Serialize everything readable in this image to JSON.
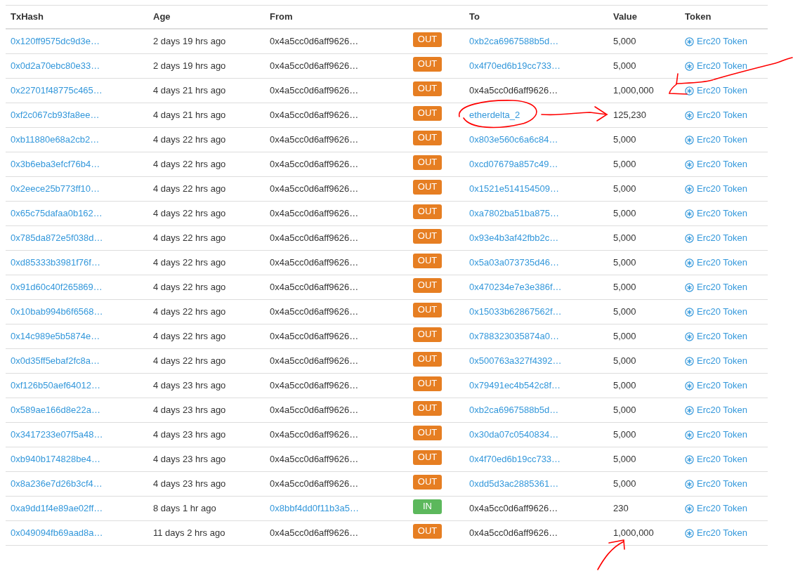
{
  "table": {
    "columns": [
      "TxHash",
      "Age",
      "From",
      "To",
      "Value",
      "Token"
    ],
    "rows": [
      {
        "txhash": "0x120ff9575dc9d3e…",
        "age": "2 days 19 hrs ago",
        "from": {
          "text": "0x4a5cc0d6aff9626…",
          "link": false
        },
        "direction": {
          "label": "OUT",
          "kind": "out"
        },
        "to": {
          "text": "0xb2ca6967588b5d…",
          "link": true
        },
        "value": "5,000",
        "token": "Erc20 Token"
      },
      {
        "txhash": "0x0d2a70ebc80e33…",
        "age": "2 days 19 hrs ago",
        "from": {
          "text": "0x4a5cc0d6aff9626…",
          "link": false
        },
        "direction": {
          "label": "OUT",
          "kind": "out"
        },
        "to": {
          "text": "0x4f70ed6b19cc733…",
          "link": true
        },
        "value": "5,000",
        "token": "Erc20 Token"
      },
      {
        "txhash": "0x22701f48775c465…",
        "age": "4 days 21 hrs ago",
        "from": {
          "text": "0x4a5cc0d6aff9626…",
          "link": false
        },
        "direction": {
          "label": "OUT",
          "kind": "out"
        },
        "to": {
          "text": "0x4a5cc0d6aff9626…",
          "link": false
        },
        "value": "1,000,000",
        "token": "Erc20 Token"
      },
      {
        "txhash": "0xf2c067cb93fa8ee…",
        "age": "4 days 21 hrs ago",
        "from": {
          "text": "0x4a5cc0d6aff9626…",
          "link": false
        },
        "direction": {
          "label": "OUT",
          "kind": "out"
        },
        "to": {
          "text": "etherdelta_2",
          "link": true
        },
        "value": "125,230",
        "token": "Erc20 Token"
      },
      {
        "txhash": "0xb11880e68a2cb2…",
        "age": "4 days 22 hrs ago",
        "from": {
          "text": "0x4a5cc0d6aff9626…",
          "link": false
        },
        "direction": {
          "label": "OUT",
          "kind": "out"
        },
        "to": {
          "text": "0x803e560c6a6c84…",
          "link": true
        },
        "value": "5,000",
        "token": "Erc20 Token"
      },
      {
        "txhash": "0x3b6eba3efcf76b4…",
        "age": "4 days 22 hrs ago",
        "from": {
          "text": "0x4a5cc0d6aff9626…",
          "link": false
        },
        "direction": {
          "label": "OUT",
          "kind": "out"
        },
        "to": {
          "text": "0xcd07679a857c49…",
          "link": true
        },
        "value": "5,000",
        "token": "Erc20 Token"
      },
      {
        "txhash": "0x2eece25b773ff10…",
        "age": "4 days 22 hrs ago",
        "from": {
          "text": "0x4a5cc0d6aff9626…",
          "link": false
        },
        "direction": {
          "label": "OUT",
          "kind": "out"
        },
        "to": {
          "text": "0x1521e514154509…",
          "link": true
        },
        "value": "5,000",
        "token": "Erc20 Token"
      },
      {
        "txhash": "0x65c75dafaa0b162…",
        "age": "4 days 22 hrs ago",
        "from": {
          "text": "0x4a5cc0d6aff9626…",
          "link": false
        },
        "direction": {
          "label": "OUT",
          "kind": "out"
        },
        "to": {
          "text": "0xa7802ba51ba875…",
          "link": true
        },
        "value": "5,000",
        "token": "Erc20 Token"
      },
      {
        "txhash": "0x785da872e5f038d…",
        "age": "4 days 22 hrs ago",
        "from": {
          "text": "0x4a5cc0d6aff9626…",
          "link": false
        },
        "direction": {
          "label": "OUT",
          "kind": "out"
        },
        "to": {
          "text": "0x93e4b3af42fbb2c…",
          "link": true
        },
        "value": "5,000",
        "token": "Erc20 Token"
      },
      {
        "txhash": "0xd85333b3981f76f…",
        "age": "4 days 22 hrs ago",
        "from": {
          "text": "0x4a5cc0d6aff9626…",
          "link": false
        },
        "direction": {
          "label": "OUT",
          "kind": "out"
        },
        "to": {
          "text": "0x5a03a073735d46…",
          "link": true
        },
        "value": "5,000",
        "token": "Erc20 Token"
      },
      {
        "txhash": "0x91d60c40f265869…",
        "age": "4 days 22 hrs ago",
        "from": {
          "text": "0x4a5cc0d6aff9626…",
          "link": false
        },
        "direction": {
          "label": "OUT",
          "kind": "out"
        },
        "to": {
          "text": "0x470234e7e3e386f…",
          "link": true
        },
        "value": "5,000",
        "token": "Erc20 Token"
      },
      {
        "txhash": "0x10bab994b6f6568…",
        "age": "4 days 22 hrs ago",
        "from": {
          "text": "0x4a5cc0d6aff9626…",
          "link": false
        },
        "direction": {
          "label": "OUT",
          "kind": "out"
        },
        "to": {
          "text": "0x15033b62867562f…",
          "link": true
        },
        "value": "5,000",
        "token": "Erc20 Token"
      },
      {
        "txhash": "0x14c989e5b5874e…",
        "age": "4 days 22 hrs ago",
        "from": {
          "text": "0x4a5cc0d6aff9626…",
          "link": false
        },
        "direction": {
          "label": "OUT",
          "kind": "out"
        },
        "to": {
          "text": "0x788323035874a0…",
          "link": true
        },
        "value": "5,000",
        "token": "Erc20 Token"
      },
      {
        "txhash": "0x0d35ff5ebaf2fc8a…",
        "age": "4 days 22 hrs ago",
        "from": {
          "text": "0x4a5cc0d6aff9626…",
          "link": false
        },
        "direction": {
          "label": "OUT",
          "kind": "out"
        },
        "to": {
          "text": "0x500763a327f4392…",
          "link": true
        },
        "value": "5,000",
        "token": "Erc20 Token"
      },
      {
        "txhash": "0xf126b50aef64012…",
        "age": "4 days 23 hrs ago",
        "from": {
          "text": "0x4a5cc0d6aff9626…",
          "link": false
        },
        "direction": {
          "label": "OUT",
          "kind": "out"
        },
        "to": {
          "text": "0x79491ec4b542c8f…",
          "link": true
        },
        "value": "5,000",
        "token": "Erc20 Token"
      },
      {
        "txhash": "0x589ae166d8e22a…",
        "age": "4 days 23 hrs ago",
        "from": {
          "text": "0x4a5cc0d6aff9626…",
          "link": false
        },
        "direction": {
          "label": "OUT",
          "kind": "out"
        },
        "to": {
          "text": "0xb2ca6967588b5d…",
          "link": true
        },
        "value": "5,000",
        "token": "Erc20 Token"
      },
      {
        "txhash": "0x3417233e07f5a48…",
        "age": "4 days 23 hrs ago",
        "from": {
          "text": "0x4a5cc0d6aff9626…",
          "link": false
        },
        "direction": {
          "label": "OUT",
          "kind": "out"
        },
        "to": {
          "text": "0x30da07c0540834…",
          "link": true
        },
        "value": "5,000",
        "token": "Erc20 Token"
      },
      {
        "txhash": "0xb940b174828be4…",
        "age": "4 days 23 hrs ago",
        "from": {
          "text": "0x4a5cc0d6aff9626…",
          "link": false
        },
        "direction": {
          "label": "OUT",
          "kind": "out"
        },
        "to": {
          "text": "0x4f70ed6b19cc733…",
          "link": true
        },
        "value": "5,000",
        "token": "Erc20 Token"
      },
      {
        "txhash": "0x8a236e7d26b3cf4…",
        "age": "4 days 23 hrs ago",
        "from": {
          "text": "0x4a5cc0d6aff9626…",
          "link": false
        },
        "direction": {
          "label": "OUT",
          "kind": "out"
        },
        "to": {
          "text": "0xdd5d3ac2885361…",
          "link": true
        },
        "value": "5,000",
        "token": "Erc20 Token"
      },
      {
        "txhash": "0xa9dd1f4e89ae02ff…",
        "age": "8 days 1 hr ago",
        "from": {
          "text": "0x8bbf4dd0f11b3a5…",
          "link": true
        },
        "direction": {
          "label": "IN",
          "kind": "in"
        },
        "to": {
          "text": "0x4a5cc0d6aff9626…",
          "link": false
        },
        "value": "230",
        "token": "Erc20 Token"
      },
      {
        "txhash": "0x049094fb69aad8a…",
        "age": "11 days 2 hrs ago",
        "from": {
          "text": "0x4a5cc0d6aff9626…",
          "link": false
        },
        "direction": {
          "label": "OUT",
          "kind": "out"
        },
        "to": {
          "text": "0x4a5cc0d6aff9626…",
          "link": false
        },
        "value": "1,000,000",
        "token": "Erc20 Token"
      }
    ]
  }
}
